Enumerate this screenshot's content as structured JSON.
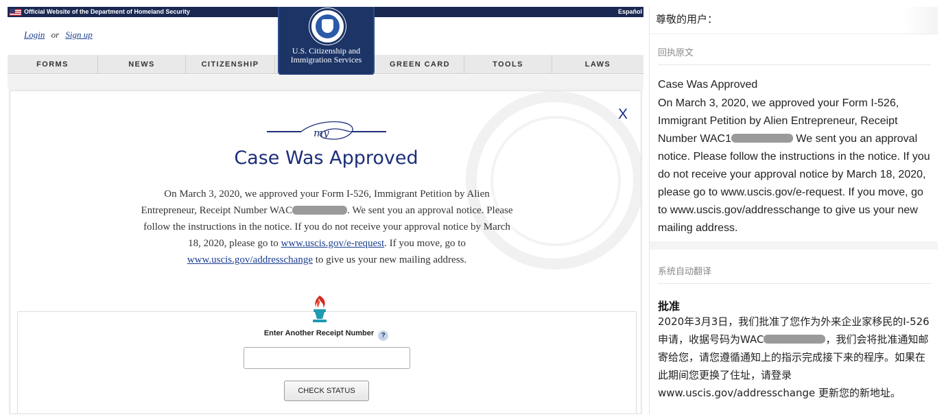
{
  "gov_bar": {
    "text": "Official Website of the Department of Homeland Security",
    "language_link": "Español"
  },
  "account": {
    "login": "Login",
    "or": "or",
    "signup": "Sign up"
  },
  "agency": {
    "name": "U.S. Citizenship and Immigration Services"
  },
  "nav": {
    "items": [
      "FORMS",
      "NEWS",
      "CITIZENSHIP",
      "GREEN CARD",
      "TOOLS",
      "LAWS"
    ]
  },
  "case": {
    "close": "X",
    "flourish_text": "my",
    "title": "Case Was Approved",
    "body_1": "On March 3, 2020, we approved your Form I-526, Immigrant Petition by Alien Entrepreneur, Receipt Number WAC",
    "body_2": ". We sent you an approval notice. Please follow the instructions in the notice. If you do not receive your approval notice by March 18, 2020, please go to ",
    "link_1": "www.uscis.gov/e-request",
    "body_3": ". If you move, go to ",
    "link_2": "www.uscis.gov/addresschange",
    "body_4": " to give us your new mailing address."
  },
  "receipt": {
    "label": "Enter Another Receipt Number",
    "help": "?",
    "input_value": "",
    "button": "CHECK STATUS"
  },
  "panel": {
    "salutation": "尊敬的用户：",
    "original_label": "回执原文",
    "original_title": "Case Was Approved",
    "original_body_1": "On March 3, 2020, we approved your Form I-526, Immigrant Petition by Alien Entrepreneur, Receipt Number WAC1",
    "original_body_2": " We sent you an approval notice. Please follow the instructions in the notice. If you do not receive your approval notice by March 18, 2020, please go to www.uscis.gov/e-request. If you move, go to www.uscis.gov/addresschange to give us your new mailing address.",
    "translation_label": "系统自动翻译",
    "translation_title": "批准",
    "translation_body_1": "2020年3月3日，我们批准了您作为外来企业家移民的I-526申请，收据号码为WAC",
    "translation_body_2": "，我们会将批准通知邮寄给您，请您遵循通知上的指示完成接下来的程序。如果在此期间您更换了住址，请登录www.uscis.gov/addresschange 更新您的新地址。"
  },
  "colors": {
    "navy": "#1c3466",
    "title_blue": "#1c2e78",
    "link_blue": "#1a3d8f",
    "torch_red": "#d42a1e",
    "torch_teal": "#1e9bb0"
  }
}
